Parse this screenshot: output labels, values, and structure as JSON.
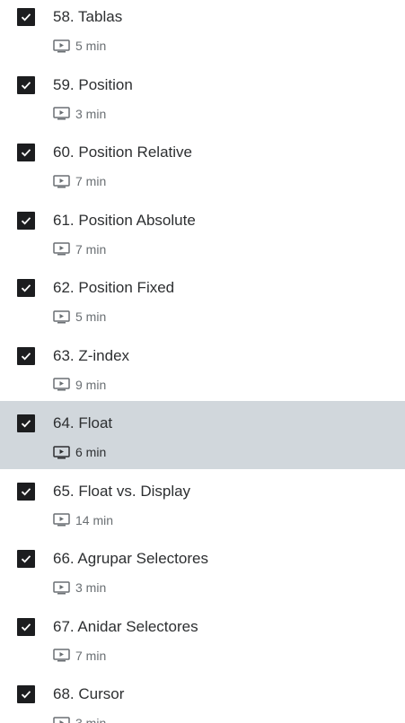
{
  "lectures": [
    {
      "title": "58. Tablas",
      "duration": "5 min",
      "completed": true,
      "active": false
    },
    {
      "title": "59. Position",
      "duration": "3 min",
      "completed": true,
      "active": false
    },
    {
      "title": "60. Position Relative",
      "duration": "7 min",
      "completed": true,
      "active": false
    },
    {
      "title": "61. Position Absolute",
      "duration": "7 min",
      "completed": true,
      "active": false
    },
    {
      "title": "62. Position Fixed",
      "duration": "5 min",
      "completed": true,
      "active": false
    },
    {
      "title": "63. Z-index",
      "duration": "9 min",
      "completed": true,
      "active": false
    },
    {
      "title": "64. Float",
      "duration": "6 min",
      "completed": true,
      "active": true
    },
    {
      "title": "65. Float vs. Display",
      "duration": "14 min",
      "completed": true,
      "active": false
    },
    {
      "title": "66. Agrupar Selectores",
      "duration": "3 min",
      "completed": true,
      "active": false
    },
    {
      "title": "67. Anidar Selectores",
      "duration": "7 min",
      "completed": true,
      "active": false
    },
    {
      "title": "68. Cursor",
      "duration": "3 min",
      "completed": true,
      "active": false
    }
  ],
  "colors": {
    "active_row_bg": "#d1d7dc",
    "checkbox_bg": "#1c1d1f",
    "text": "#2d2f31",
    "muted": "#6a6f73"
  },
  "icons": {
    "checkbox": "checkmark-icon",
    "lecture_type": "video-play-icon"
  }
}
